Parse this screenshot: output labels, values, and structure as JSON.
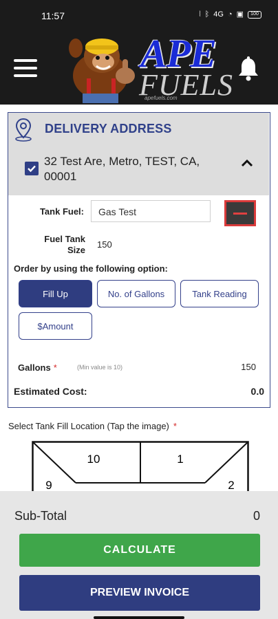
{
  "status_bar": {
    "time": "11:57",
    "network": "4G",
    "battery": "100"
  },
  "header": {
    "logo_title": "APE",
    "logo_subtitle": "FUELS",
    "logo_site": "apefuels.com",
    "menu_icon": "hamburger-menu-icon",
    "notification_icon": "bell-icon"
  },
  "delivery": {
    "title": "DELIVERY ADDRESS",
    "address": "32 Test Are, Metro, TEST, CA, 00001",
    "checked": true
  },
  "tank": {
    "fuel_label": "Tank Fuel:",
    "fuel_value": "Gas Test",
    "size_label": "Fuel Tank Size",
    "size_value": "150"
  },
  "order": {
    "prompt": "Order by using the following option:",
    "options": [
      "Fill Up",
      "No. of Gallons",
      "Tank Reading",
      "$Amount"
    ],
    "selected": "Fill Up"
  },
  "gallons": {
    "label": "Gallons",
    "required_mark": "*",
    "hint": "(Min value is 10)",
    "value": "150"
  },
  "estimate": {
    "label": "Estimated Cost:",
    "value": "0.0"
  },
  "fill_location": {
    "label": "Select Tank Fill Location (Tap the image)",
    "required_mark": "*",
    "zones": [
      "10",
      "1",
      "9",
      "2"
    ]
  },
  "summary": {
    "subtotal_label": "Sub-Total",
    "subtotal_value": "0"
  },
  "actions": {
    "calculate": "CALCULATE",
    "preview": "PREVIEW INVOICE"
  },
  "colors": {
    "primary": "#2f3d80",
    "success": "#3fa64a",
    "danger": "#d93a3a",
    "header_bg": "#1b1b1b"
  }
}
